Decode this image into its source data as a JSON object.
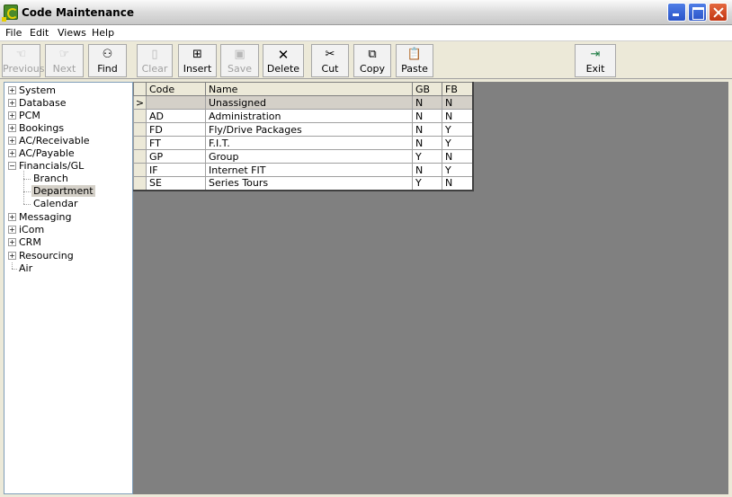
{
  "window": {
    "title": "Code Maintenance"
  },
  "menu": [
    "File",
    "Edit",
    "Views",
    "Help"
  ],
  "toolbar": {
    "previous": "Previous",
    "next": "Next",
    "find": "Find",
    "clear": "Clear",
    "insert": "Insert",
    "save": "Save",
    "delete": "Delete",
    "cut": "Cut",
    "copy": "Copy",
    "paste": "Paste",
    "exit": "Exit"
  },
  "tree": {
    "system": "System",
    "database": "Database",
    "pcm": "PCM",
    "bookings": "Bookings",
    "ac_receivable": "AC/Receivable",
    "ac_payable": "AC/Payable",
    "financials_gl": "Financials/GL",
    "branch": "Branch",
    "department": "Department",
    "calendar": "Calendar",
    "messaging": "Messaging",
    "icom": "iCom",
    "crm": "CRM",
    "resourcing": "Resourcing",
    "air": "Air"
  },
  "grid": {
    "headers": {
      "code": "Code",
      "name": "Name",
      "gb": "GB",
      "fb": "FB"
    },
    "current_marker": ">",
    "rows": [
      {
        "code": "",
        "name": "Unassigned",
        "gb": "N",
        "fb": "N"
      },
      {
        "code": "AD",
        "name": "Administration",
        "gb": "N",
        "fb": "N"
      },
      {
        "code": "FD",
        "name": "Fly/Drive Packages",
        "gb": "N",
        "fb": "Y"
      },
      {
        "code": "FT",
        "name": "F.I.T.",
        "gb": "N",
        "fb": "Y"
      },
      {
        "code": "GP",
        "name": "Group",
        "gb": "Y",
        "fb": "N"
      },
      {
        "code": "IF",
        "name": "Internet FIT",
        "gb": "N",
        "fb": "Y"
      },
      {
        "code": "SE",
        "name": "Series Tours",
        "gb": "Y",
        "fb": "N"
      }
    ]
  }
}
